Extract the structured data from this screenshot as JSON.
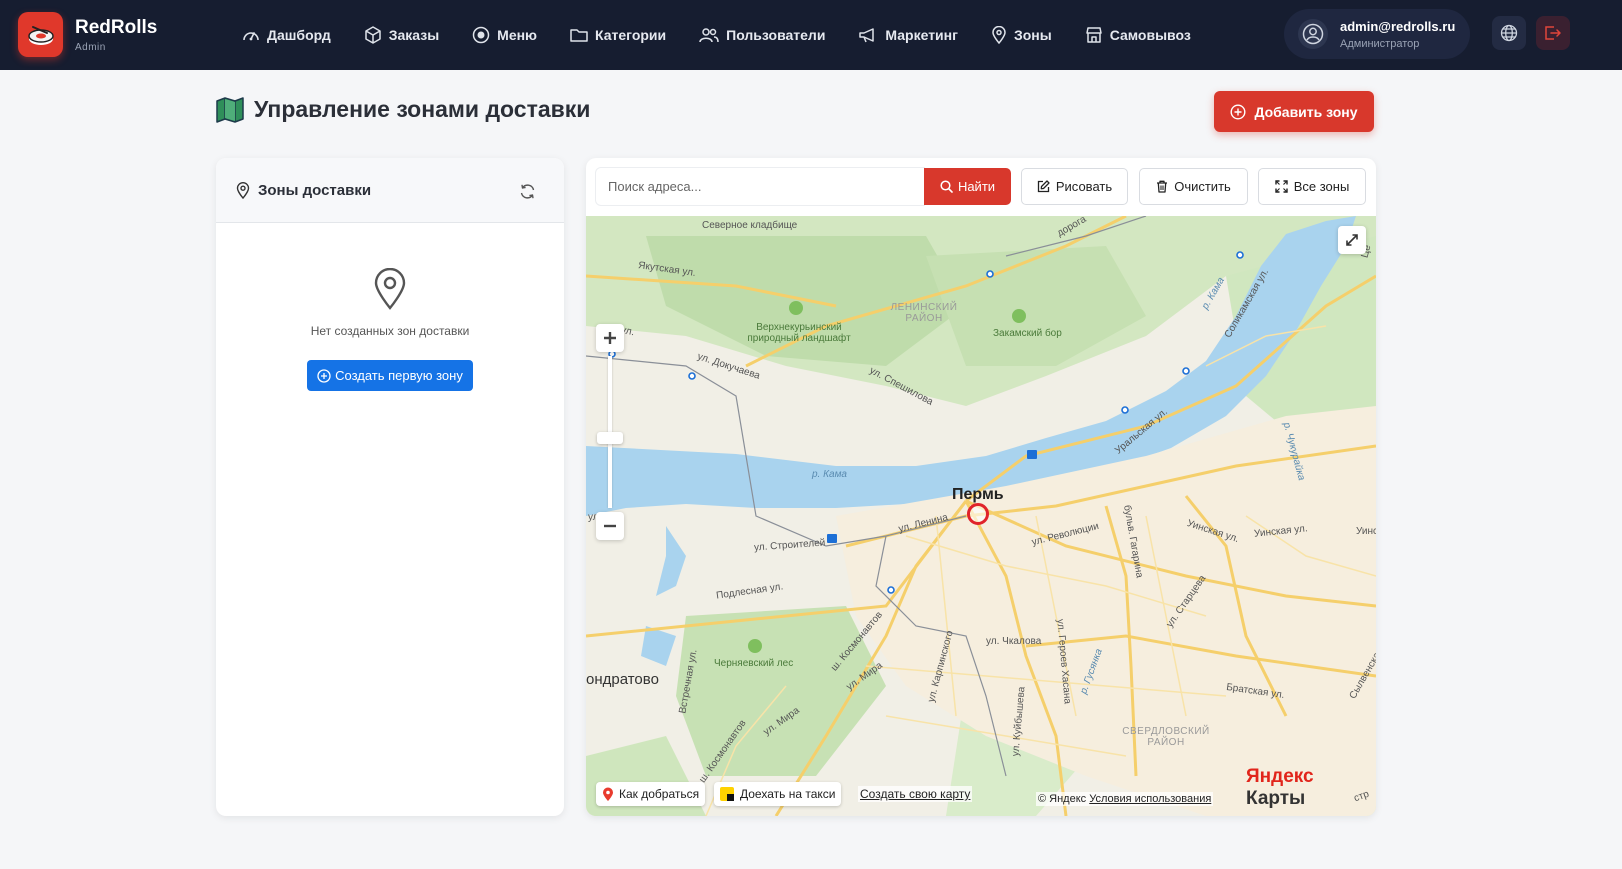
{
  "brand": {
    "name": "RedRolls",
    "sub": "Admin",
    "accent": "#e0382b"
  },
  "nav": [
    {
      "label": "Дашборд",
      "icon": "dashboard-icon"
    },
    {
      "label": "Заказы",
      "icon": "box-icon"
    },
    {
      "label": "Меню",
      "icon": "menu-icon"
    },
    {
      "label": "Категории",
      "icon": "folder-icon"
    },
    {
      "label": "Пользователи",
      "icon": "users-icon"
    },
    {
      "label": "Маркетинг",
      "icon": "megaphone-icon"
    },
    {
      "label": "Зоны",
      "icon": "map-pin-icon"
    },
    {
      "label": "Самовывоз",
      "icon": "store-icon"
    }
  ],
  "user": {
    "email": "admin@redrolls.ru",
    "role": "Администратор"
  },
  "page": {
    "title": "Управление зонами доставки",
    "add_zone": "Добавить зону"
  },
  "zones": {
    "title": "Зоны доставки",
    "empty_text": "Нет созданных зон доставки",
    "create_first": "Создать первую зону"
  },
  "map_toolbar": {
    "search_placeholder": "Поиск адреса...",
    "find": "Найти",
    "draw": "Рисовать",
    "clear": "Очистить",
    "all_zones": "Все зоны"
  },
  "map": {
    "city": "Пермь",
    "big_place": "ондратово",
    "districts": [
      "ЛЕНИНСКИЙ РАЙОН",
      "СВЕРДЛОВСКИЙ РАЙОН"
    ],
    "parks": [
      "Верхнекурьинский природный ландшафт",
      "Закамский бор",
      "Черняевский лес"
    ],
    "cemetery": "Северное кладбище",
    "river": "р. Кама",
    "streets": {
      "yakutskaya": "Якутская ул.",
      "dokuchaeva": "ул. Докучаева",
      "speshilova": "ул. Спешилова",
      "lenina": "ул. Ленина",
      "stroiteley": "ул. Строителей",
      "podlesnaya": "Подлесная ул.",
      "revolyutsii": "ул. Революции",
      "uralskaya": "Уральская ул.",
      "solikamskaya": "Соликамская ул.",
      "gagarina": "бульв. Гагарина",
      "uinskaya": "Уинская ул.",
      "uinskaya2": "Уинская ул.",
      "uinskaya3": "Уинс",
      "startseva": "ул. Старцева",
      "chkalova": "ул. Чкалова",
      "kosmonavtov": "ш. Космонавтов",
      "mira": "ул. Мира",
      "mira2": "ул. Мира",
      "karpinskogo": "ул. Карпинского",
      "kuybysheva": "ул. Куйбышева",
      "geroev": "ул. Героев Хасана",
      "bratskaya": "Братская ул.",
      "vstrechnaya": "Встречная ул.",
      "kosmonavtov2": "ш. Космонавтов",
      "doroga": "дорога",
      "chukhurka": "р. Чукурайка",
      "gusinka": "р. Гусянка",
      "kama_small": "р. Кама",
      "ul": "ул.",
      "syevenskaya": "Сылвенская ул.",
      "ce": "Це",
      "str": "стр",
      "ul2": "ул"
    },
    "route": "Как добраться",
    "taxi": "Доехать на такси",
    "create_map": "Создать свою карту",
    "copyright": "© Яндекс",
    "terms": "Условия использования",
    "logo_a": "Яндекс",
    "logo_b": "Карты"
  }
}
